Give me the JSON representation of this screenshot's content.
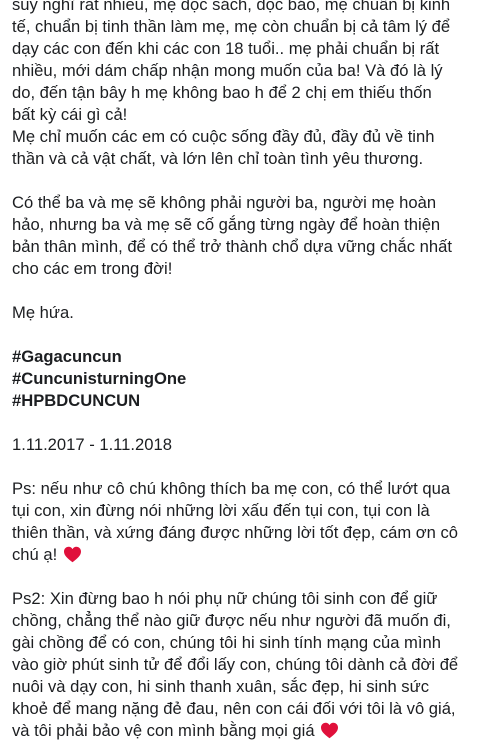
{
  "post": {
    "paragraph1": [
      "suy nghĩ rất nhiều, mẹ đọc sách, đọc báo, mẹ chuẩn bị kinh",
      "tế, chuẩn bị tinh thần làm mẹ, mẹ còn chuẩn bị cả tâm lý để",
      "dạy các con đến khi các con 18 tuổi.. mẹ phải chuẩn bị rất",
      "nhiều, mới dám chấp nhận mong muốn của ba! Và đó là lý",
      "do, đến tận bây h mẹ không bao h để 2 chị em thiếu thốn",
      "bất kỳ cái gì cả!",
      "Mẹ chỉ muốn các em có cuộc sống đầy đủ, đầy đủ về tinh",
      "thần và cả vật chất, và lớn lên chỉ toàn tình yêu thương."
    ],
    "paragraph2": [
      "Có thể ba và mẹ sẽ không phải người ba, người mẹ hoàn",
      "hảo, nhưng ba và mẹ sẽ cố gắng từng ngày để hoàn thiện",
      "bản thân mình, để có thể trở thành chổ dựa vững chắc nhất",
      "cho các em trong đời!"
    ],
    "promise": "Mẹ hứa.",
    "hashtags": [
      "#Gagacuncun",
      "#CuncunisturningOne",
      "#HPBDCUNCUN"
    ],
    "date_range": "1.11.2017 - 1.11.2018",
    "ps1": [
      "Ps: nếu như cô chú không thích ba mẹ con, có thể lướt qua",
      "tụi con, xin đừng nói những lời xấu đến tụi con, tụi con là",
      "thiên thần, và xứng đáng được những lời tốt đẹp, cám ơn cô"
    ],
    "ps1_last": "chú ạ!",
    "ps2": [
      "Ps2: Xin đừng bao h nói phụ nữ chúng tôi sinh con để giữ",
      "chồng, chẳng thể nào giữ được nếu như người đã muốn đi,",
      "gài chồng để có con, chúng tôi hi sinh tính mạng của mình",
      "vào giờ phút sinh tử để đổi lấy con, chúng tôi dành cả đời để",
      "nuôi và dạy con, hi sinh thanh xuân, sắc đẹp, hi sinh sức",
      "khoẻ để mang nặng đẻ đau, nên con cái đối với tôi là vô giá,"
    ],
    "ps2_last": "và tôi phải bảo vệ con mình bằng mọi giá",
    "heart_icon": "red-heart-icon",
    "heart_color": "#e0103b"
  }
}
